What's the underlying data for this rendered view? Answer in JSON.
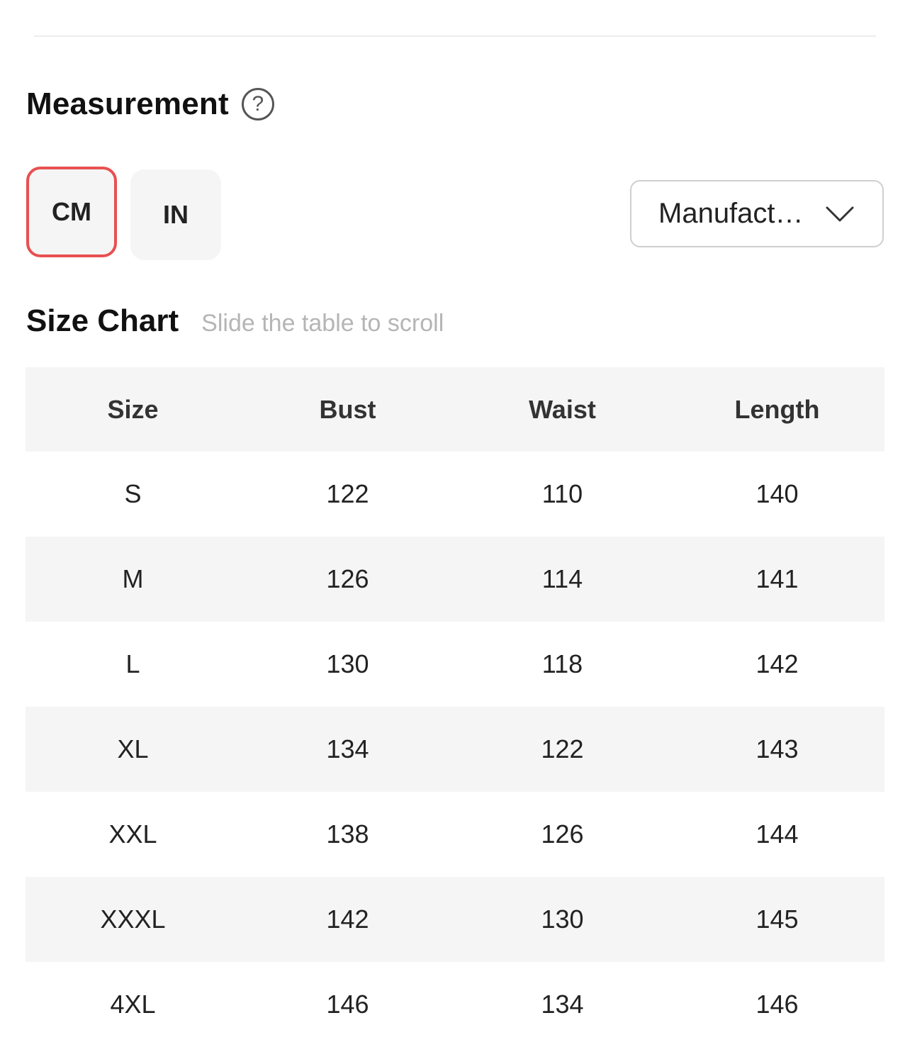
{
  "measurement": {
    "title": "Measurement",
    "help_icon": "question-circle-icon",
    "units": [
      "CM",
      "IN"
    ],
    "selected_unit": "CM",
    "accent_color": "#e85050"
  },
  "dropdown": {
    "value": "Manufact…",
    "icon": "chevron-down-icon"
  },
  "size_chart": {
    "title": "Size Chart",
    "hint": "Slide the table to scroll",
    "columns": [
      "Size",
      "Bust",
      "Waist",
      "Length"
    ],
    "rows": [
      [
        "S",
        "122",
        "110",
        "140"
      ],
      [
        "M",
        "126",
        "114",
        "141"
      ],
      [
        "L",
        "130",
        "118",
        "142"
      ],
      [
        "XL",
        "134",
        "122",
        "143"
      ],
      [
        "XXL",
        "138",
        "126",
        "144"
      ],
      [
        "XXXL",
        "142",
        "130",
        "145"
      ],
      [
        "4XL",
        "146",
        "134",
        "146"
      ]
    ]
  }
}
